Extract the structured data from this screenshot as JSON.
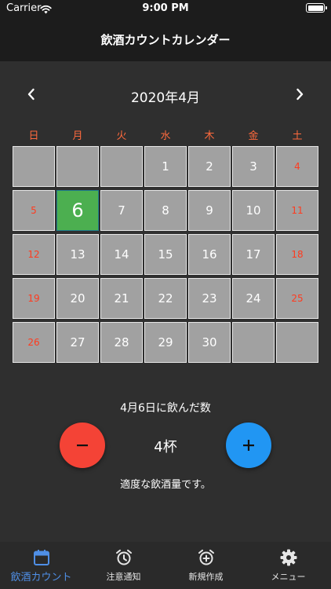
{
  "status_bar": {
    "carrier": "Carrier",
    "time": "9:00 PM"
  },
  "nav": {
    "title": "飲酒カウントカレンダー"
  },
  "calendar": {
    "month_title": "2020年4月",
    "weekdays": [
      "日",
      "月",
      "火",
      "水",
      "木",
      "金",
      "土"
    ],
    "weeks": [
      [
        "",
        "",
        "",
        "1",
        "2",
        "3",
        "4"
      ],
      [
        "5",
        "6",
        "7",
        "8",
        "9",
        "10",
        "11"
      ],
      [
        "12",
        "13",
        "14",
        "15",
        "16",
        "17",
        "18"
      ],
      [
        "19",
        "20",
        "21",
        "22",
        "23",
        "24",
        "25"
      ],
      [
        "26",
        "27",
        "28",
        "29",
        "30",
        "",
        ""
      ]
    ],
    "selected_day": "6"
  },
  "counter": {
    "label": "4月6日に飲んだ数",
    "count": "4杯",
    "message": "適度な飲酒量です。"
  },
  "colors": {
    "accent": "#4f8fe6",
    "today": "#4caf50",
    "minus": "#f44336",
    "plus": "#2196f3",
    "weekend": "#ff3b1f"
  },
  "tabs": [
    {
      "label": "飲酒カウント",
      "icon": "calendar-icon",
      "active": true
    },
    {
      "label": "注意通知",
      "icon": "alarm-clock-icon",
      "active": false
    },
    {
      "label": "新規作成",
      "icon": "alarm-add-icon",
      "active": false
    },
    {
      "label": "メニュー",
      "icon": "gear-icon",
      "active": false
    }
  ]
}
